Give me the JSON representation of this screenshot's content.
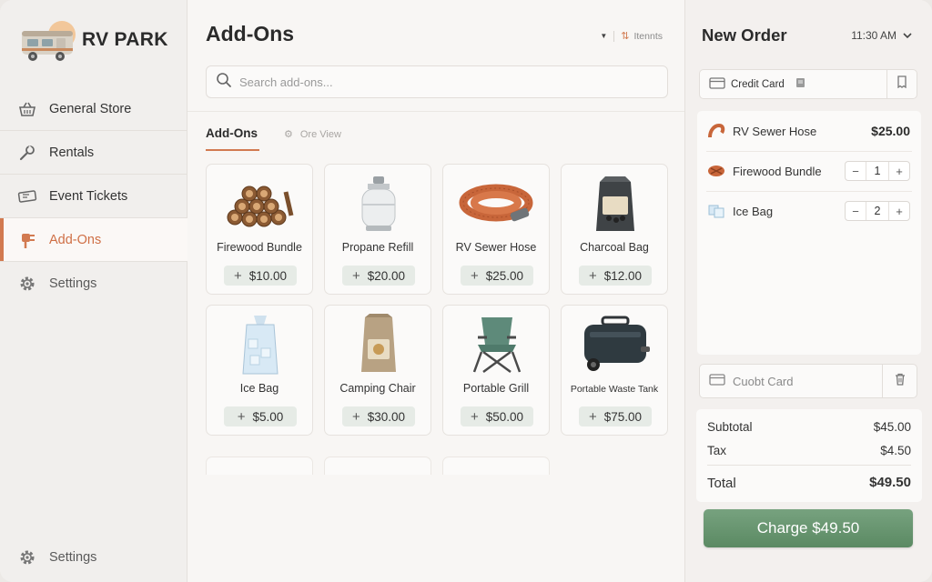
{
  "brand": {
    "name": "RV PARK"
  },
  "sidebar": {
    "items": [
      {
        "label": "General Store",
        "icon": "basket-icon"
      },
      {
        "label": "Rentals",
        "icon": "wrench-icon"
      },
      {
        "label": "Event Tickets",
        "icon": "ticket-icon"
      },
      {
        "label": "Add-Ons",
        "icon": "plug-icon",
        "active": true
      },
      {
        "label": "Settings",
        "icon": "gear-icon"
      }
    ],
    "bottom_settings": "Settings"
  },
  "main": {
    "title": "Add-Ons",
    "header_control": "Itennts",
    "search_placeholder": "Search add-ons...",
    "tabs": [
      {
        "label": "Add-Ons",
        "active": true
      },
      {
        "label": "Ore View"
      }
    ],
    "products": [
      {
        "name": "Firewood Bundle",
        "price": "$10.00"
      },
      {
        "name": "Propane Refill",
        "price": "$20.00"
      },
      {
        "name": "RV Sewer Hose",
        "price": "$25.00"
      },
      {
        "name": "Charcoal Bag",
        "price": "$12.00"
      },
      {
        "name": "Ice Bag",
        "price": "$5.00"
      },
      {
        "name": "Camping Chair",
        "price": "$30.00"
      },
      {
        "name": "Portable Grill",
        "price": "$50.00"
      },
      {
        "name": "Portable Waste Tank",
        "price": "$75.00"
      }
    ],
    "plus_symbol": "+"
  },
  "order": {
    "title": "New Order",
    "time": "11:30 AM",
    "payment_method": "Credit Card",
    "items": [
      {
        "name": "RV Sewer Hose",
        "price": "$25.00"
      },
      {
        "name": "Firewood Bundle",
        "qty": "1"
      },
      {
        "name": "Ice Bag",
        "qty": "2"
      }
    ],
    "payment_method_2": "Cuobt Card",
    "subtotal_label": "Subtotal",
    "subtotal": "$45.00",
    "tax_label": "Tax",
    "tax": "$4.50",
    "total_label": "Total",
    "total": "$49.50",
    "charge_label": "Charge $49.50"
  },
  "colors": {
    "accent": "#d27a50",
    "charge": "#6b9873",
    "price_button": "#e6ebe6"
  }
}
